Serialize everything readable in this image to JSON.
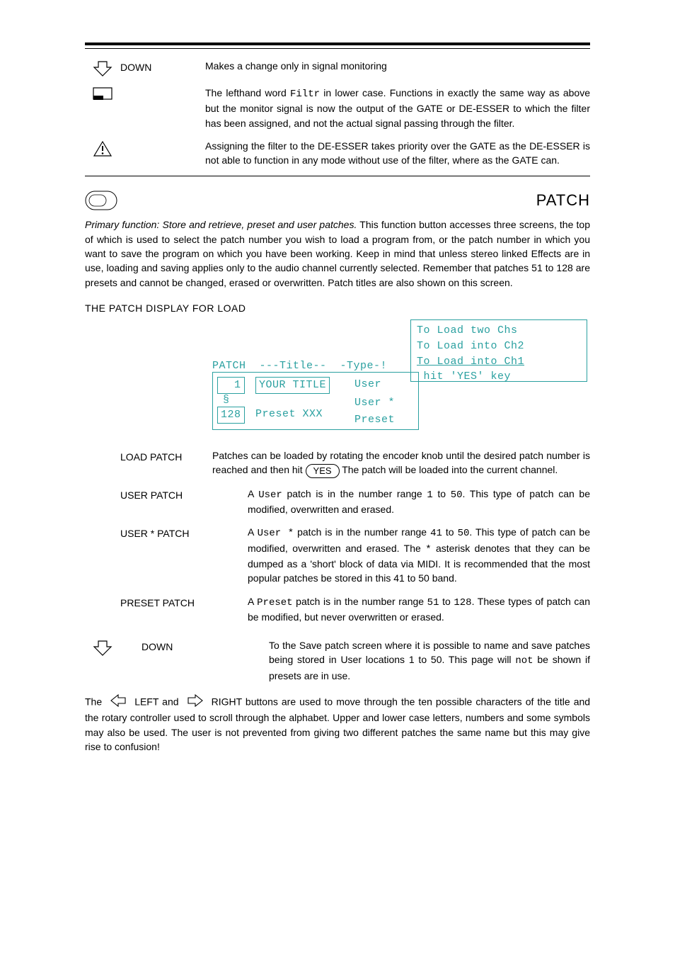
{
  "top": {
    "down_label": "DOWN",
    "down_text": "Makes  a change only in signal monitoring",
    "filtr_text_a": "The lefthand word ",
    "filtr_word": "Filtr",
    "filtr_text_b": " in lower case. Functions in exactly the same way as above but the monitor signal is now the output of the GATE or DE-ESSER to which the filter has been assigned, and not the actual signal passing through the filter.",
    "warn_text": "Assigning the filter to the DE-ESSER takes priority over the GATE as the DE-ESSER is not able to function in any mode without use of the filter, where as the GATE can."
  },
  "patch": {
    "title": "PATCH",
    "primary_lead": "Primary function:  Store and retrieve, preset and user patches.",
    "primary_body": " This function button accesses three screens, the top of which is used to select the patch number you wish to load a program from, or the patch number in which you want to save the program on which you have been working. Keep in mind that unless stereo linked Effects are in use, loading and saving applies only to the audio channel currently selected. Remember that patches 51 to 128 are presets and cannot be changed, erased or overwritten. Patch titles are also shown on this screen.",
    "load_heading": "THE PATCH DISPLAY FOR LOAD",
    "lcd": {
      "header": "PATCH  ---Title--  -Type-!",
      "row1_num": "  1",
      "row1_title": "YOUR TITLE",
      "row1_type": "User",
      "row2_num": "128",
      "row2_title": "Preset XXX",
      "row2_type1": "User *",
      "row2_type2": "Preset",
      "side1": "To Load two Chs",
      "side2": "To Load into Ch2",
      "side3": "To Load into Ch1",
      "side4": " hit 'YES' key"
    },
    "load_patch_label": "LOAD PATCH",
    "load_patch_a": "Patches can be loaded by rotating the encoder knob until the desired patch number is reached and then hit",
    "yes_btn": "YES",
    "load_patch_b": "The patch will be loaded into the current channel.",
    "user_patch_label": "USER PATCH",
    "user_patch_a": "A ",
    "user_word": "User",
    "user_patch_b": " patch is in the number range ",
    "n1": "1",
    "to": " to ",
    "n50": "50",
    "user_patch_c": ". This type of patch can be modified, overwritten and erased.",
    "userstar_label": "USER * PATCH",
    "userstar_a": "A ",
    "userstar_word": "User *",
    "userstar_b": " patch is in the number range ",
    "n41": "41",
    "userstar_c": ". This type of patch can be modified, overwritten and erased. The ",
    "asterisk": "*",
    "userstar_d": " asterisk denotes that they can be dumped as a 'short' block of data via MIDI. It is recommended that the most popular patches be stored in this 41 to 50 band.",
    "preset_label": "PRESET PATCH",
    "preset_a": "A ",
    "preset_word": "Preset",
    "preset_b": " patch is in the number range ",
    "n51": "51",
    "n128": "128",
    "preset_c": ". These types of patch can be modified, but never overwritten or erased.",
    "down2_label": "DOWN",
    "down2_a": "To the Save patch screen where it is possible to name and save patches being stored in User locations 1 to 50. This page will ",
    "down2_not": "not",
    "down2_b": " be shown if presets are in use.",
    "nav_a": "The",
    "nav_left": "LEFT and",
    "nav_right": "RIGHT buttons are used to move through the ten possible",
    "nav_body": "characters of the title and the rotary controller used to scroll through the alphabet. Upper and lower case letters, numbers and some symbols may also be used. The user is not prevented from giving two different patches the same name but this may give rise to confusion!"
  }
}
